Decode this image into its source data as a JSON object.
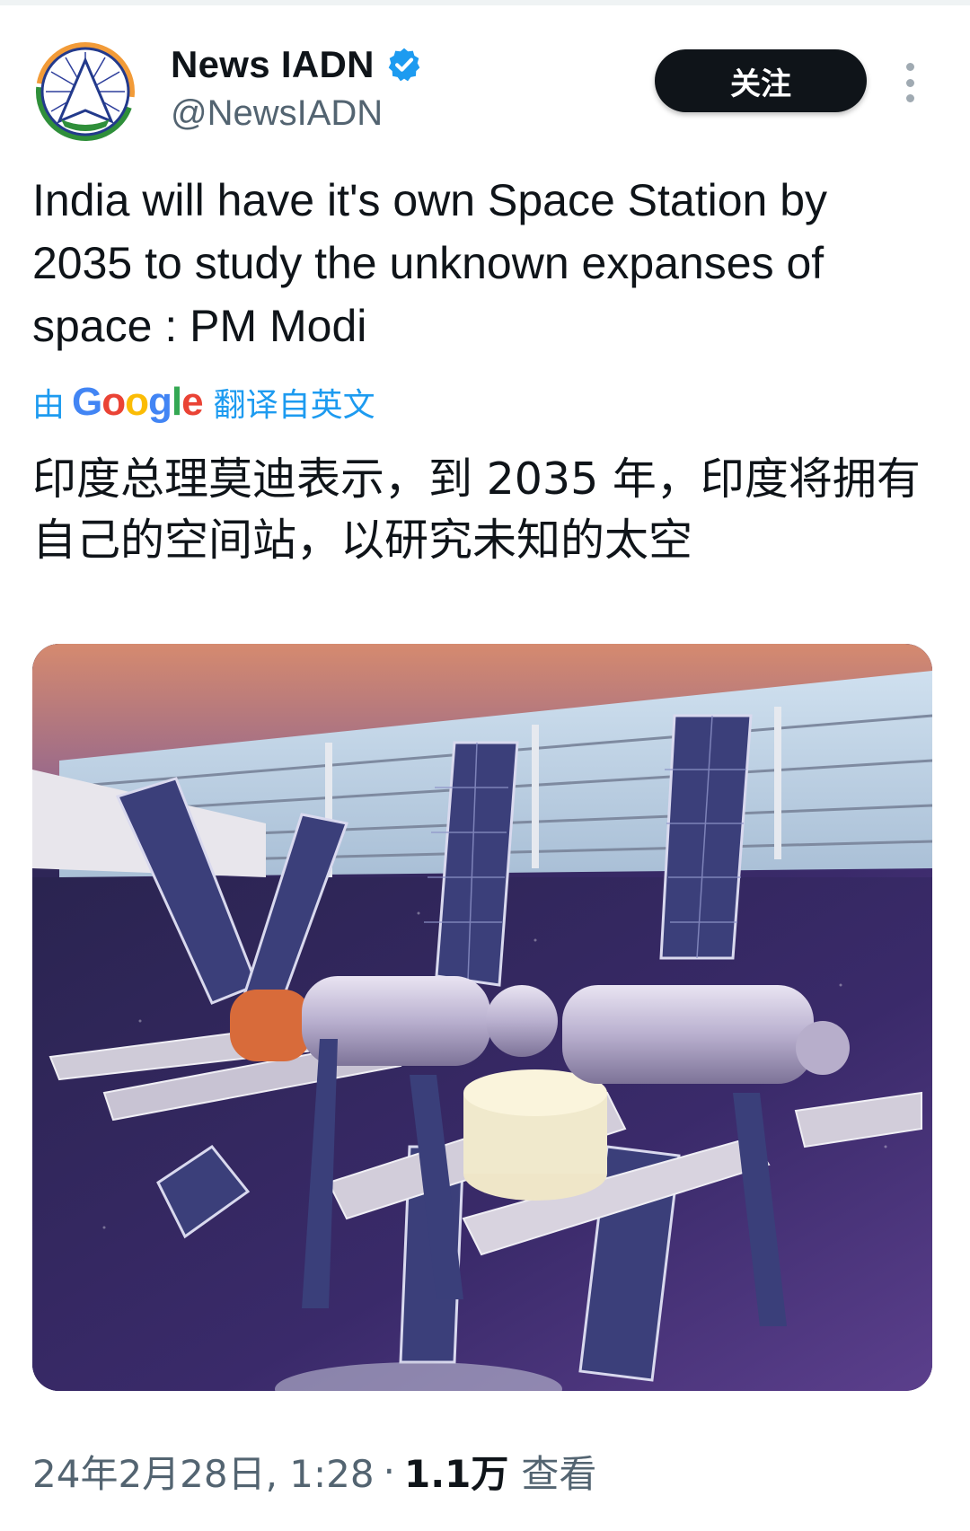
{
  "author": {
    "display_name": "News IADN",
    "handle": "@NewsIADN",
    "verified": true,
    "avatar_icon": "iadn-logo-icon"
  },
  "actions": {
    "follow_label": "关注",
    "more_icon": "more-vertical-icon"
  },
  "tweet": {
    "text": "India will have it's own Space Station by 2035 to study the unknown expanses of space : PM Modi",
    "translation": {
      "prefix": "由",
      "provider": "Google",
      "suffix": "翻译自英文",
      "text": "印度总理莫迪表示，到 2035 年，印度将拥有自己的空间站，以研究未知的太空"
    },
    "media": {
      "type": "photo",
      "subject": "space-station-model"
    }
  },
  "meta": {
    "timestamp": "24年2月28日, 1:28",
    "separator": "·",
    "views_count": "1.1万",
    "views_label": "查看"
  },
  "colors": {
    "text_primary": "#0f1419",
    "text_secondary": "#536471",
    "link_blue": "#1d9bf0",
    "follow_bg": "#0f1419"
  }
}
